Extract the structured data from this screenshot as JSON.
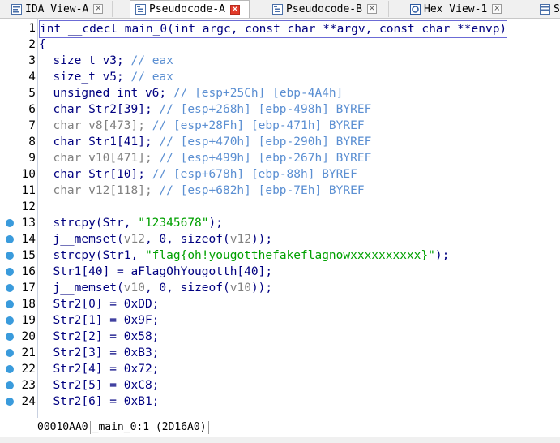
{
  "tabs": [
    {
      "label": "IDA View-A",
      "icon": "ida-view-icon",
      "active": false
    },
    {
      "label": "Pseudocode-A",
      "icon": "pseudocode-icon",
      "active": true
    },
    {
      "label": "Pseudocode-B",
      "icon": "pseudocode-icon",
      "active": false
    },
    {
      "label": "Hex View-1",
      "icon": "hex-view-icon",
      "active": false
    },
    {
      "label": "S",
      "icon": "structures-icon",
      "active": false
    }
  ],
  "close_glyph": "×",
  "lines": [
    {
      "n": "1",
      "bp": false,
      "parts": [
        [
          "k",
          "int __cdecl main_0(int argc, const char **argv, const char **envp)"
        ]
      ]
    },
    {
      "n": "2",
      "bp": false,
      "parts": [
        [
          "k",
          "{"
        ]
      ]
    },
    {
      "n": "3",
      "bp": false,
      "parts": [
        [
          "k",
          "  size_t v3; "
        ],
        [
          "cm",
          "// eax"
        ]
      ]
    },
    {
      "n": "4",
      "bp": false,
      "parts": [
        [
          "k",
          "  size_t v5; "
        ],
        [
          "cm",
          "// eax"
        ]
      ]
    },
    {
      "n": "5",
      "bp": false,
      "parts": [
        [
          "k",
          "  unsigned int v6; "
        ],
        [
          "cm",
          "// [esp+25Ch] [ebp-4A4h]"
        ]
      ]
    },
    {
      "n": "6",
      "bp": false,
      "parts": [
        [
          "k",
          "  char Str2[39]; "
        ],
        [
          "cm",
          "// [esp+268h] [ebp-498h] BYREF"
        ]
      ]
    },
    {
      "n": "7",
      "bp": false,
      "parts": [
        [
          "gr",
          "  char v8[473]; "
        ],
        [
          "cm",
          "// [esp+28Fh] [ebp-471h] BYREF"
        ]
      ]
    },
    {
      "n": "8",
      "bp": false,
      "parts": [
        [
          "k",
          "  char Str1[41]; "
        ],
        [
          "cm",
          "// [esp+470h] [ebp-290h] BYREF"
        ]
      ]
    },
    {
      "n": "9",
      "bp": false,
      "parts": [
        [
          "gr",
          "  char v10[471]; "
        ],
        [
          "cm",
          "// [esp+499h] [ebp-267h] BYREF"
        ]
      ]
    },
    {
      "n": "10",
      "bp": false,
      "parts": [
        [
          "k",
          "  char Str[10]; "
        ],
        [
          "cm",
          "// [esp+678h] [ebp-88h] BYREF"
        ]
      ]
    },
    {
      "n": "11",
      "bp": false,
      "parts": [
        [
          "gr",
          "  char v12[118]; "
        ],
        [
          "cm",
          "// [esp+682h] [ebp-7Eh] BYREF"
        ]
      ]
    },
    {
      "n": "12",
      "bp": false,
      "parts": [
        [
          "k",
          ""
        ]
      ]
    },
    {
      "n": "13",
      "bp": true,
      "parts": [
        [
          "k",
          "  strcpy(Str, "
        ],
        [
          "st",
          "\"12345678\""
        ],
        [
          "k",
          ");"
        ]
      ]
    },
    {
      "n": "14",
      "bp": true,
      "parts": [
        [
          "k",
          "  j__memset("
        ],
        [
          "gr",
          "v12"
        ],
        [
          "k",
          ", 0, sizeof("
        ],
        [
          "gr",
          "v12"
        ],
        [
          "k",
          "));"
        ]
      ]
    },
    {
      "n": "15",
      "bp": true,
      "parts": [
        [
          "k",
          "  strcpy(Str1, "
        ],
        [
          "st",
          "\"flag{oh!yougotthefakeflagnowxxxxxxxxxx}\""
        ],
        [
          "k",
          ");"
        ]
      ]
    },
    {
      "n": "16",
      "bp": true,
      "parts": [
        [
          "k",
          "  Str1[40] = aFlagOhYougotth[40];"
        ]
      ]
    },
    {
      "n": "17",
      "bp": true,
      "parts": [
        [
          "k",
          "  j__memset("
        ],
        [
          "gr",
          "v10"
        ],
        [
          "k",
          ", 0, sizeof("
        ],
        [
          "gr",
          "v10"
        ],
        [
          "k",
          "));"
        ]
      ]
    },
    {
      "n": "18",
      "bp": true,
      "parts": [
        [
          "k",
          "  Str2[0] = 0xDD;"
        ]
      ]
    },
    {
      "n": "19",
      "bp": true,
      "parts": [
        [
          "k",
          "  Str2[1] = 0x9F;"
        ]
      ]
    },
    {
      "n": "20",
      "bp": true,
      "parts": [
        [
          "k",
          "  Str2[2] = 0x58;"
        ]
      ]
    },
    {
      "n": "21",
      "bp": true,
      "parts": [
        [
          "k",
          "  Str2[3] = 0xB3;"
        ]
      ]
    },
    {
      "n": "22",
      "bp": true,
      "parts": [
        [
          "k",
          "  Str2[4] = 0x72;"
        ]
      ]
    },
    {
      "n": "23",
      "bp": true,
      "parts": [
        [
          "k",
          "  Str2[5] = 0xC8;"
        ]
      ]
    },
    {
      "n": "24",
      "bp": true,
      "parts": [
        [
          "k",
          "  Str2[6] = 0xB1;"
        ]
      ]
    }
  ],
  "status": {
    "address": "00010AA0",
    "location": "_main_0:1",
    "offset": "(2D16A0)"
  },
  "colors": {
    "code": "#000080",
    "comment": "#5b8fd2",
    "grey": "#808080",
    "string": "#00a000",
    "breakpoint": "#3a9bdc",
    "active_close": "#e23a2a"
  }
}
